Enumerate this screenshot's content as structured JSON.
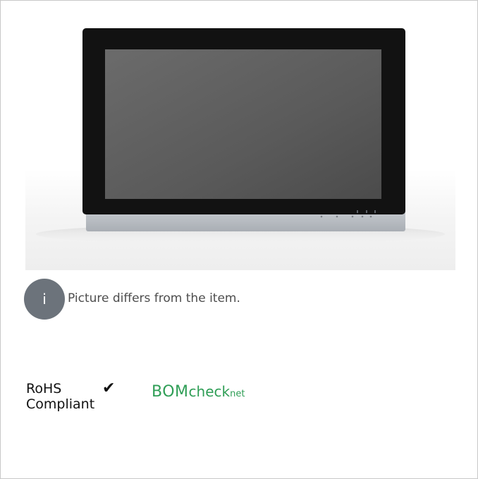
{
  "product": {
    "image_alt": "Touch panel product image",
    "screen_color": "#5e5e5e",
    "bezel_color": "#111111",
    "frame_color": "#b8bdc3"
  },
  "notice": {
    "icon": "info-icon",
    "icon_glyph": "i",
    "text": "Picture differs from the item.",
    "badge_color": "#6c737b"
  },
  "certifications": {
    "rohs": {
      "line1": "RoHS",
      "line2": "Compliant",
      "check_glyph": "✔"
    },
    "bomcheck": {
      "part1": "BOM",
      "part2": "check",
      "part3": "net",
      "color": "#2f9e56"
    }
  }
}
